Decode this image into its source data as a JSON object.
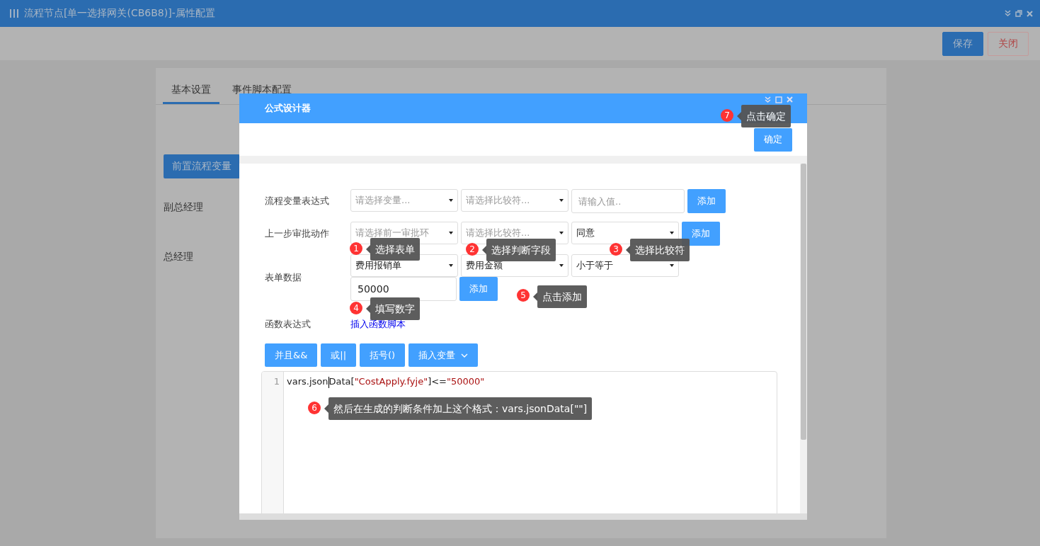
{
  "window": {
    "title": "流程节点[单一选择网关(CB6B8)]-属性配置"
  },
  "toolbar": [
    {
      "label": "保存",
      "kind": "primary"
    },
    {
      "label": "关闭",
      "kind": "danger"
    }
  ],
  "tabs": [
    {
      "label": "基本设置",
      "selected": true
    },
    {
      "label": "事件脚本配置",
      "selected": false
    }
  ],
  "side_button": "前置流程变量",
  "approvers": [
    "副总经理",
    "总经理"
  ],
  "dialog": {
    "title": "公式设计器",
    "confirm": "确定",
    "rows": [
      {
        "label": "流程变量表达式",
        "lines": [
          [
            {
              "kind": "select",
              "placeholder": "请选择变量..."
            },
            {
              "kind": "select",
              "placeholder": "请选择比较符..."
            },
            {
              "kind": "input",
              "placeholder": "请输入值.."
            },
            {
              "kind": "button",
              "label": "添加"
            }
          ]
        ]
      },
      {
        "label": "上一步审批动作",
        "lines": [
          [
            {
              "kind": "select",
              "placeholder": "请选择前一审批环"
            },
            {
              "kind": "select",
              "placeholder": "请选择比较符..."
            },
            {
              "kind": "select",
              "value": "同意"
            },
            {
              "kind": "button",
              "label": "添加"
            }
          ]
        ]
      },
      {
        "label": "表单数据",
        "lines": [
          [
            {
              "kind": "select",
              "value": "费用报销单"
            },
            {
              "kind": "select",
              "value": "费用金额"
            },
            {
              "kind": "select",
              "value": "小于等于"
            }
          ],
          [
            {
              "kind": "input",
              "value": "50000"
            },
            {
              "kind": "button",
              "label": "添加"
            }
          ]
        ]
      }
    ],
    "function_row": {
      "label": "函数表达式",
      "link": "插入函数脚本"
    },
    "operators": [
      {
        "label": "并且&&",
        "kind": "button"
      },
      {
        "label": "或||",
        "kind": "button"
      },
      {
        "label": "括号()",
        "kind": "button"
      },
      {
        "label": "插入变量",
        "kind": "dropdown"
      }
    ],
    "editor": {
      "lines": [
        {
          "number": "1",
          "segments": [
            {
              "kind": "plain",
              "text": "vars.json"
            },
            {
              "kind": "cursor"
            },
            {
              "kind": "plain",
              "text": "Data["
            },
            {
              "kind": "string",
              "text": "\"CostApply.fyje\""
            },
            {
              "kind": "plain",
              "text": "]<="
            },
            {
              "kind": "string",
              "text": "\"50000\""
            }
          ]
        }
      ]
    }
  },
  "callouts": [
    {
      "number": "1",
      "text": "选择表单"
    },
    {
      "number": "2",
      "text": "选择判断字段"
    },
    {
      "number": "3",
      "text": "选择比较符"
    },
    {
      "number": "4",
      "text": "填写数字"
    },
    {
      "number": "5",
      "text": "点击添加"
    },
    {
      "number": "6",
      "text": "然后在生成的判断条件加上这个格式：vars.jsonData[\"\"]"
    },
    {
      "number": "7",
      "text": "点击确定"
    }
  ]
}
